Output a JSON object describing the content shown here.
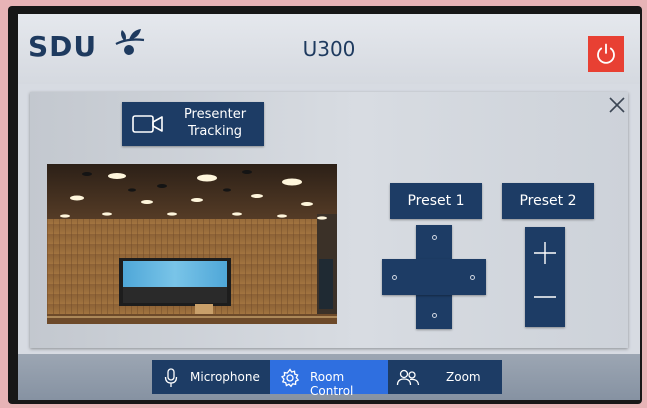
{
  "header": {
    "logo_text": "SDU",
    "room_name": "U300"
  },
  "panel": {
    "presenter_tracking_label": "Presenter Tracking",
    "presets": [
      {
        "label": "Preset 1"
      },
      {
        "label": "Preset 2"
      }
    ]
  },
  "nav": {
    "tabs": [
      {
        "label": "Microphone",
        "icon": "microphone-icon",
        "active": false
      },
      {
        "label": "Room Control",
        "icon": "gear-icon",
        "active": true
      },
      {
        "label": "Zoom",
        "icon": "users-icon",
        "active": false
      }
    ]
  },
  "colors": {
    "button_bg": "#1d3c65",
    "active_tab_bg": "#2f6fe0",
    "power_button": "#e84033",
    "brand_text": "#1e3a5f"
  }
}
